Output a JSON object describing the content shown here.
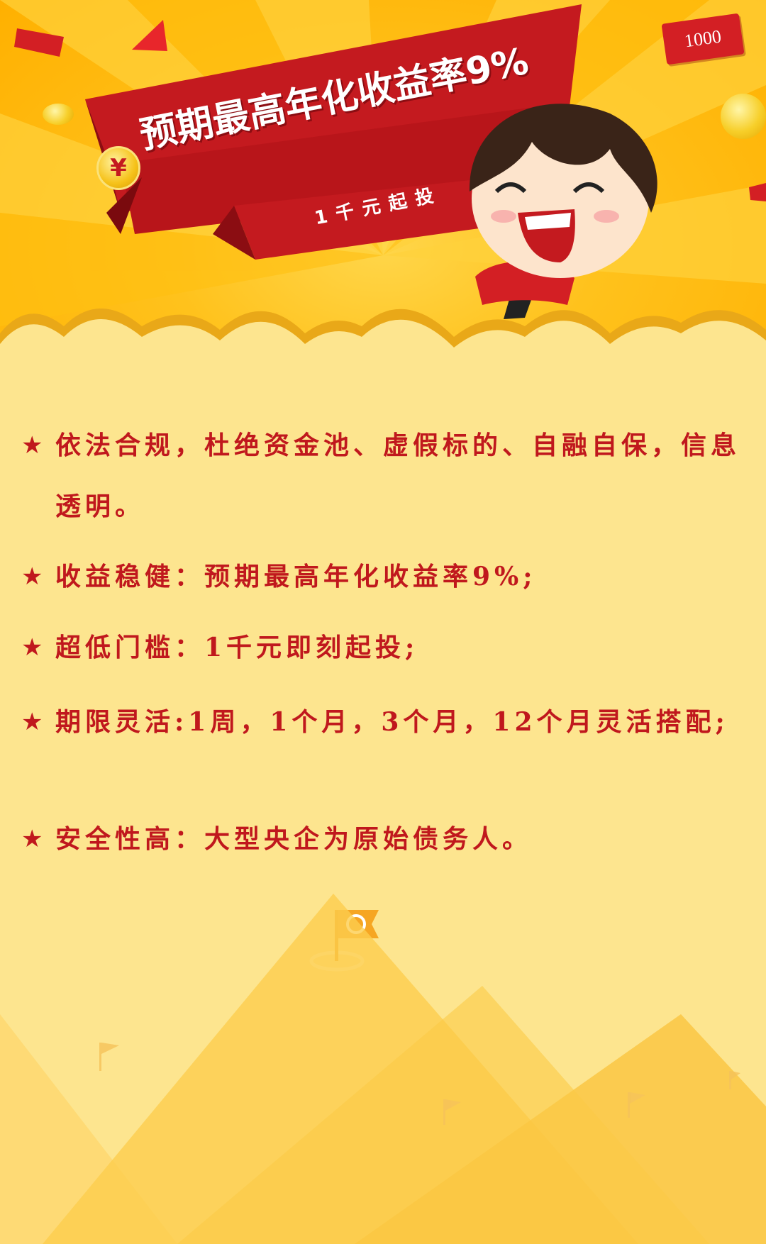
{
  "banner": {
    "headline": "预期最高年化收益率9%",
    "subline": "1千元起投",
    "yen_symbol": "¥",
    "coin_tag": "1000",
    "colors": {
      "red": "#c41a1f",
      "dark_red": "#8b0d12",
      "yellow": "#ffc21c"
    }
  },
  "features": [
    {
      "star": "★",
      "text": "依法合规，杜绝资金池、虚假标的、自融自保，信息透明。"
    },
    {
      "star": "★",
      "text": "收益稳健：预期最高年化收益率9%;"
    },
    {
      "star": "★",
      "text": "超低门槛：1千元即刻起投;"
    },
    {
      "star": "★",
      "text": "期限灵活:1周，1个月，3个月，12个月灵活搭配;"
    },
    {
      "star": "★",
      "text": "安全性高：大型央企为原始债务人。"
    }
  ],
  "icons": [
    "yen-coin-icon",
    "mascot-illustration",
    "flag-logo-icon",
    "gold-coin-icon",
    "red-confetti-icon"
  ]
}
